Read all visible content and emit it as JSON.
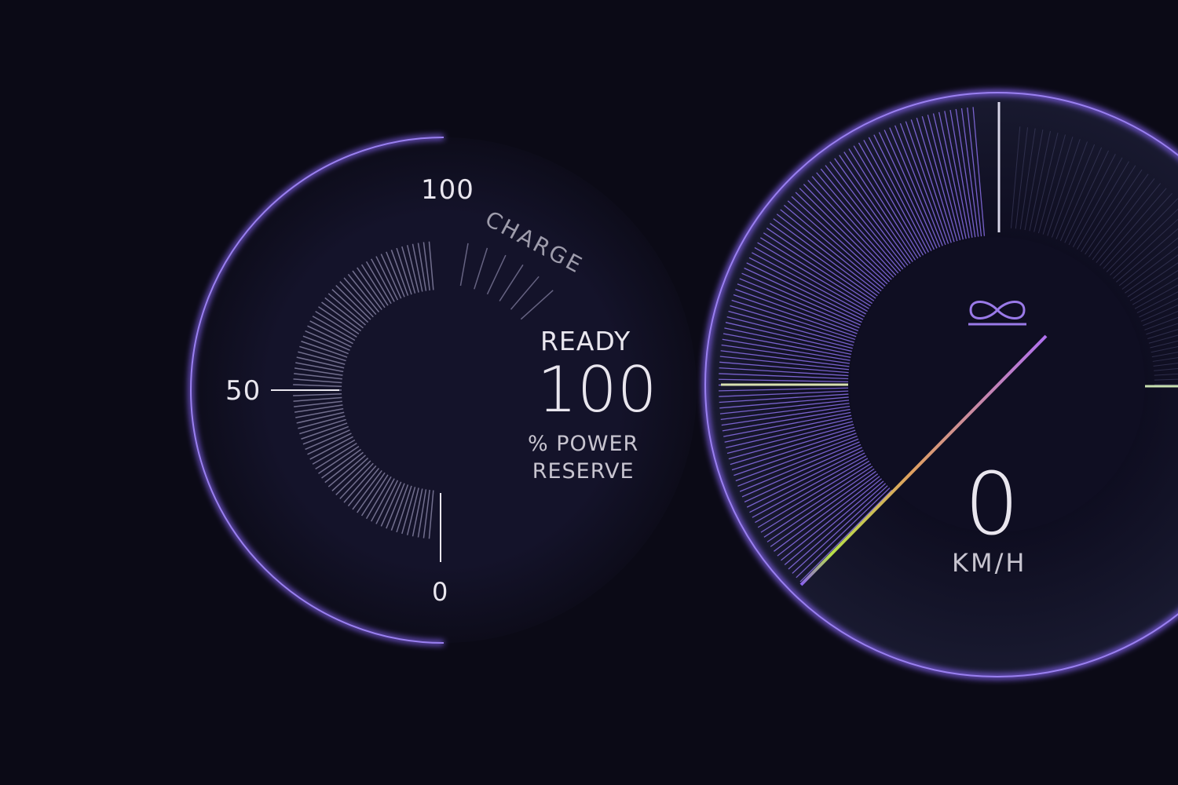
{
  "charge_gauge": {
    "title": "CHARGE",
    "scale_labels": {
      "max": "100",
      "mid": "50",
      "min": "0"
    },
    "value_percent": 100
  },
  "power_reserve": {
    "status": "READY",
    "value": "100",
    "unit_line1": "% POWER",
    "unit_line2": "RESERVE"
  },
  "speedometer": {
    "value": "0",
    "unit": "KM/H",
    "mode_icon": "infinity-icon"
  },
  "colors": {
    "background": "#0b0a16",
    "ring": "#7a5ce0",
    "needle_start": "#b8e04a",
    "needle_end": "#a070f0",
    "tick": "#8a86a8"
  }
}
